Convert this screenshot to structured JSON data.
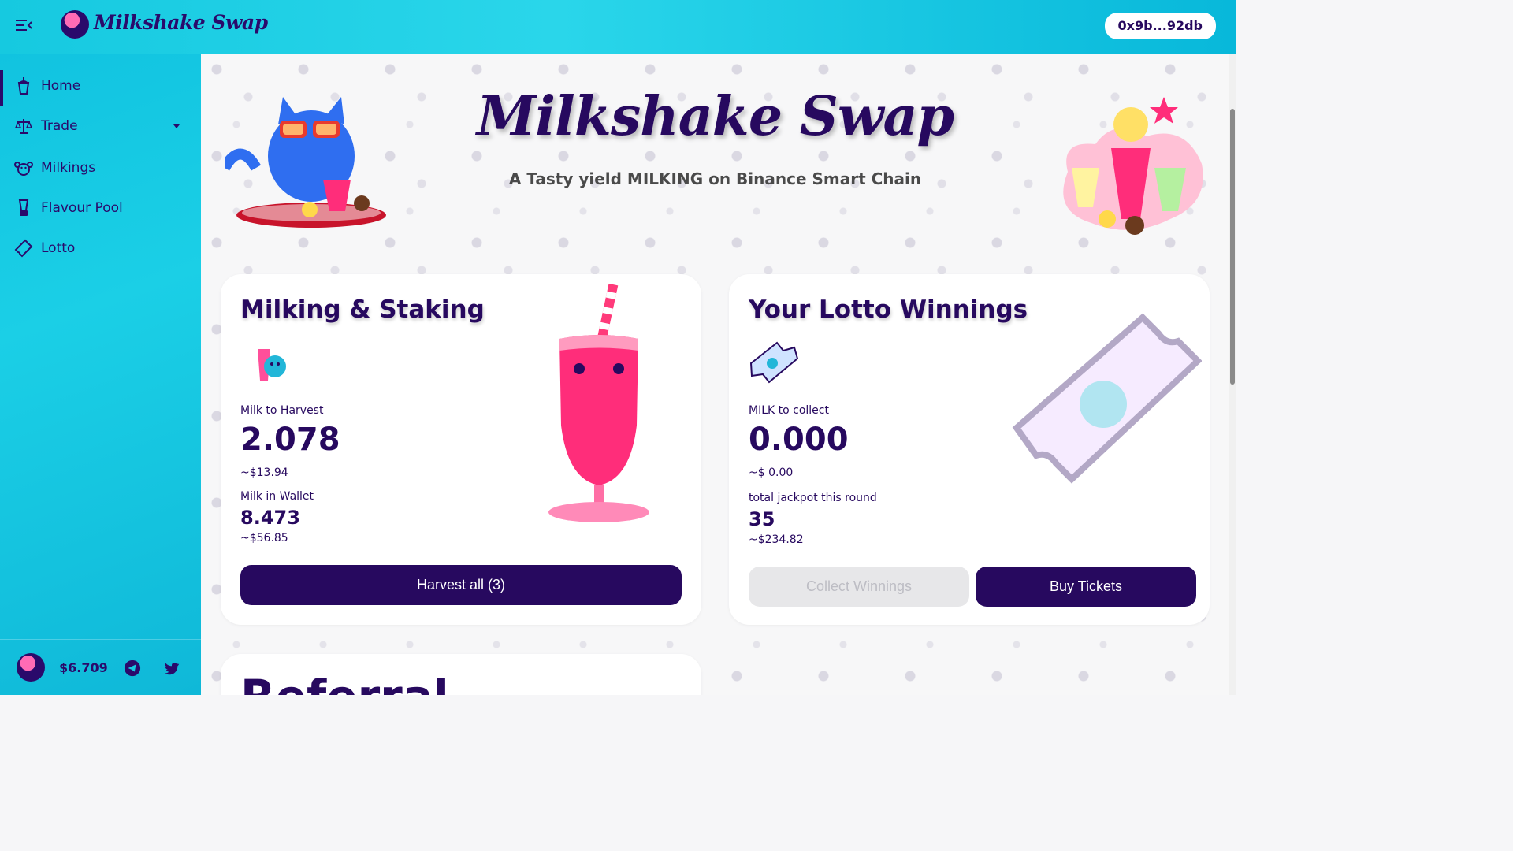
{
  "header": {
    "app_name": "Milkshake Swap",
    "wallet_address": "0x9b...92db"
  },
  "sidebar": {
    "items": [
      {
        "label": "Home",
        "icon": "milkshake-cup-icon",
        "active": true
      },
      {
        "label": "Trade",
        "icon": "scales-icon",
        "has_dropdown": true
      },
      {
        "label": "Milkings",
        "icon": "cow-icon"
      },
      {
        "label": "Flavour Pool",
        "icon": "blender-icon"
      },
      {
        "label": "Lotto",
        "icon": "ticket-icon"
      }
    ],
    "footer": {
      "price": "$6.709",
      "icons": [
        "telegram-icon",
        "twitter-icon"
      ]
    }
  },
  "hero": {
    "title": "Milkshake Swap",
    "subtitle": "A Tasty yield MILKING on Binance Smart Chain"
  },
  "staking_card": {
    "title": "Milking & Staking",
    "harvest_label": "Milk to Harvest",
    "harvest_value": "2.078",
    "harvest_usd": "~$13.94",
    "wallet_label": "Milk in Wallet",
    "wallet_value": "8.473",
    "wallet_usd": "~$56.85",
    "button": "Harvest all (3)"
  },
  "lotto_card": {
    "title": "Your Lotto Winnings",
    "collect_label": "MILK to collect",
    "collect_value": "0.000",
    "collect_usd": "~$ 0.00",
    "jackpot_label": "total jackpot this round",
    "jackpot_value": "35",
    "jackpot_usd": "~$234.82",
    "collect_button": "Collect Winnings",
    "buy_button": "Buy Tickets"
  },
  "referral_card": {
    "title": "Referral"
  },
  "colors": {
    "brand_dark": "#27095f",
    "cyan": "#16c9e0",
    "pink": "#ff2d7a"
  }
}
